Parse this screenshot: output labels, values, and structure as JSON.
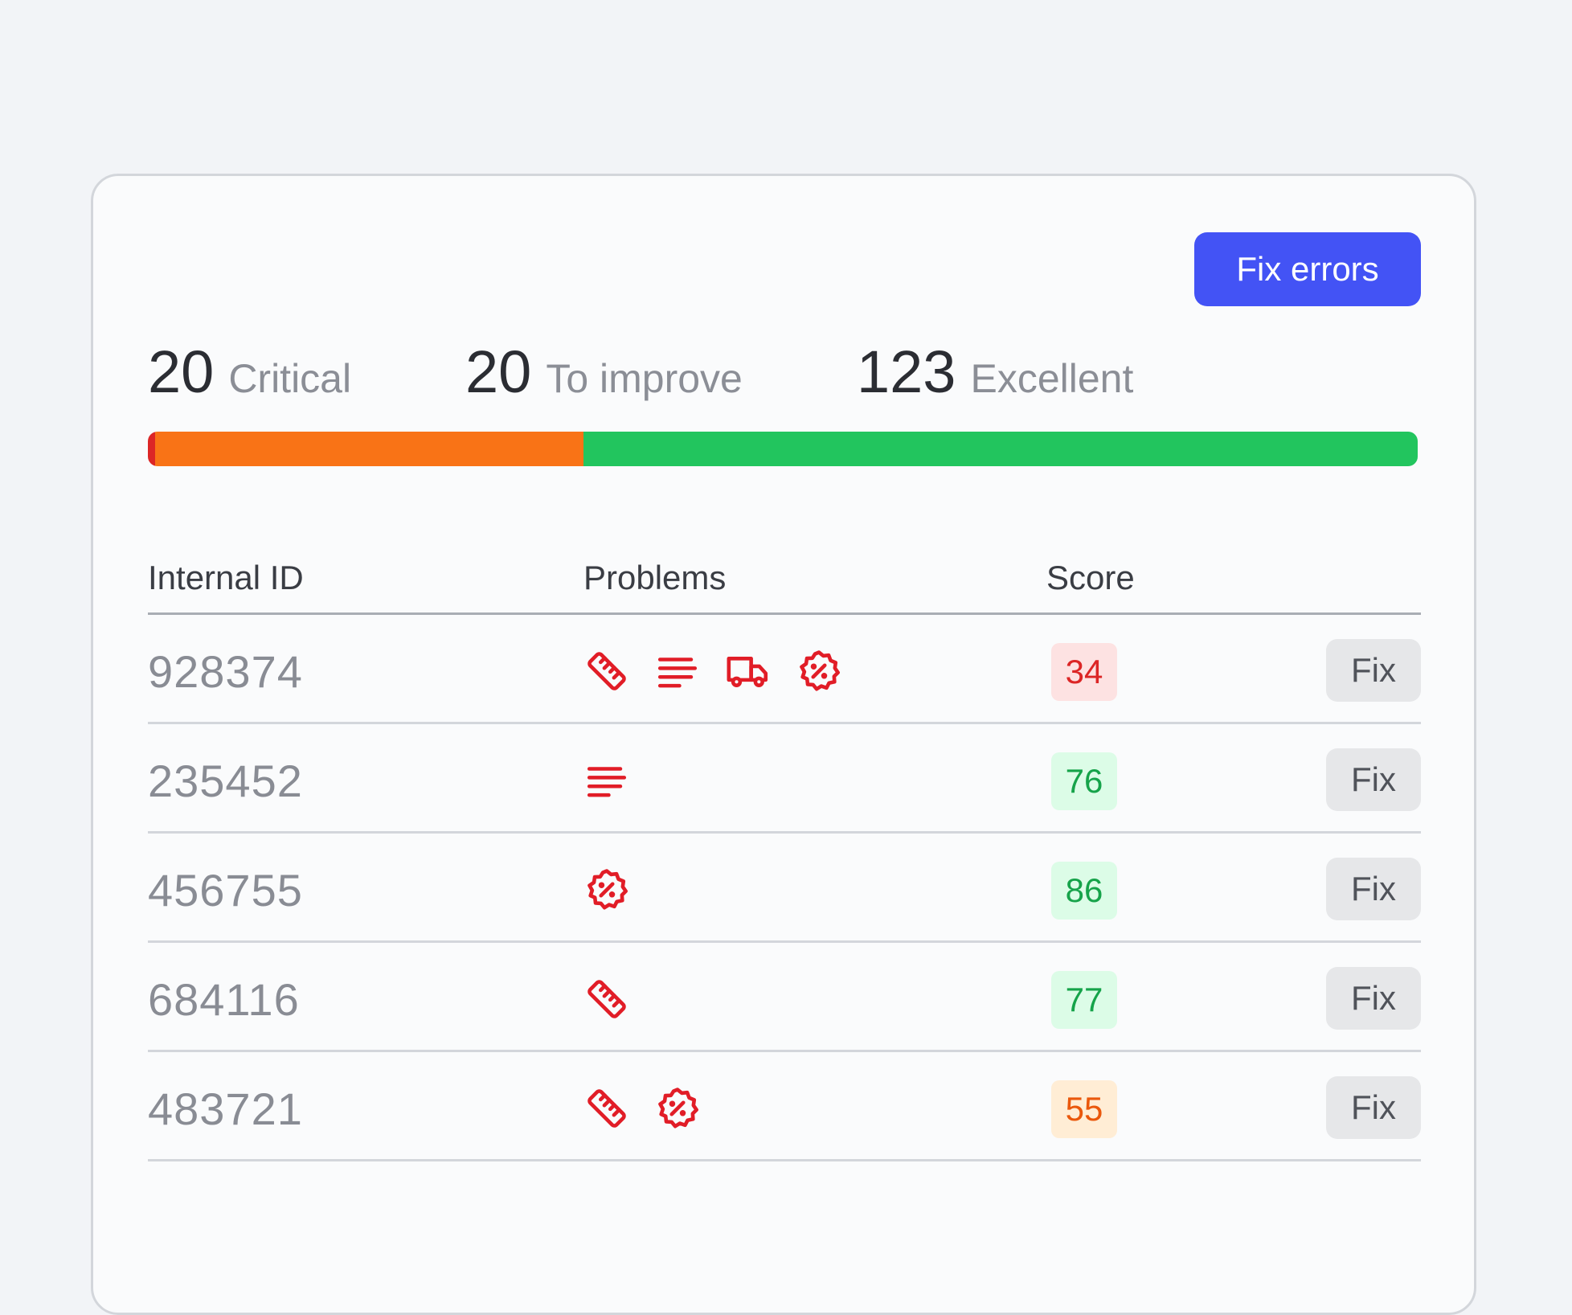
{
  "actions": {
    "fix_errors_label": "Fix errors"
  },
  "summary": [
    {
      "count": "20",
      "label": "Critical",
      "color": "#dc2626"
    },
    {
      "count": "20",
      "label": "To improve",
      "color": "#f97316"
    },
    {
      "count": "123",
      "label": "Excellent",
      "color": "#22c55e"
    }
  ],
  "distribution_bar": [
    {
      "key": "critical",
      "fraction": 0.006,
      "color": "#dc2626"
    },
    {
      "key": "to_improve",
      "fraction": 0.337,
      "color": "#f97316"
    },
    {
      "key": "excellent",
      "fraction": 0.657,
      "color": "#22c55e"
    }
  ],
  "table": {
    "columns": [
      "Internal ID",
      "Problems",
      "Score"
    ],
    "fix_label": "Fix",
    "rows": [
      {
        "id": "928374",
        "problems": [
          "ruler-icon",
          "text-lines-icon",
          "truck-icon",
          "discount-badge-icon"
        ],
        "score": "34",
        "level": "red"
      },
      {
        "id": "235452",
        "problems": [
          "text-lines-icon"
        ],
        "score": "76",
        "level": "green"
      },
      {
        "id": "456755",
        "problems": [
          "discount-badge-icon"
        ],
        "score": "86",
        "level": "green"
      },
      {
        "id": "684116",
        "problems": [
          "ruler-icon"
        ],
        "score": "77",
        "level": "green"
      },
      {
        "id": "483721",
        "problems": [
          "ruler-icon",
          "discount-badge-icon"
        ],
        "score": "55",
        "level": "orange"
      }
    ]
  },
  "colors": {
    "accent": "#4353f5",
    "problem_icon": "#e11d27"
  }
}
